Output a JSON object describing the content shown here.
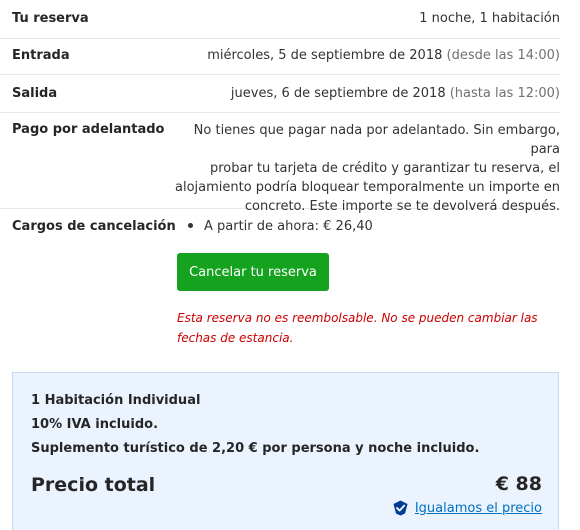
{
  "reservation": {
    "label": "Tu reserva",
    "value": "1 noche, 1 habitación"
  },
  "checkin": {
    "label": "Entrada",
    "date": "miércoles, 5 de septiembre de 2018",
    "time": "(desde las 14:00)"
  },
  "checkout": {
    "label": "Salida",
    "date": "jueves, 6 de septiembre de 2018",
    "time": "(hasta las 12:00)"
  },
  "prepayment": {
    "label": "Pago por adelantado",
    "lines": [
      "No tienes que pagar nada por adelantado. Sin embargo, para",
      "probar tu tarjeta de crédito y garantizar tu reserva, el",
      "alojamiento podría bloquear temporalmente un importe en",
      "concreto. Este importe se te devolverá después."
    ]
  },
  "cancellation": {
    "label": "Cargos de cancelación",
    "items": [
      "A partir de ahora: € 26,40"
    ],
    "button": "Cancelar tu reserva",
    "warning_lines": [
      "Esta reserva no es reembolsable. No se pueden cambiar las",
      "fechas de estancia."
    ]
  },
  "summary": {
    "room": "1 Habitación Individual",
    "vat": "10% IVA incluido.",
    "tourist_tax": "Suplemento turístico de 2,20 € por persona y noche incluido.",
    "total_label": "Precio total",
    "total_value": "€ 88",
    "price_match": "Igualamos el precio"
  },
  "colors": {
    "accent_green": "#15a21f",
    "warning_red": "#cc0000",
    "link_blue": "#0071c2",
    "summary_bg": "#ebf3ff"
  }
}
